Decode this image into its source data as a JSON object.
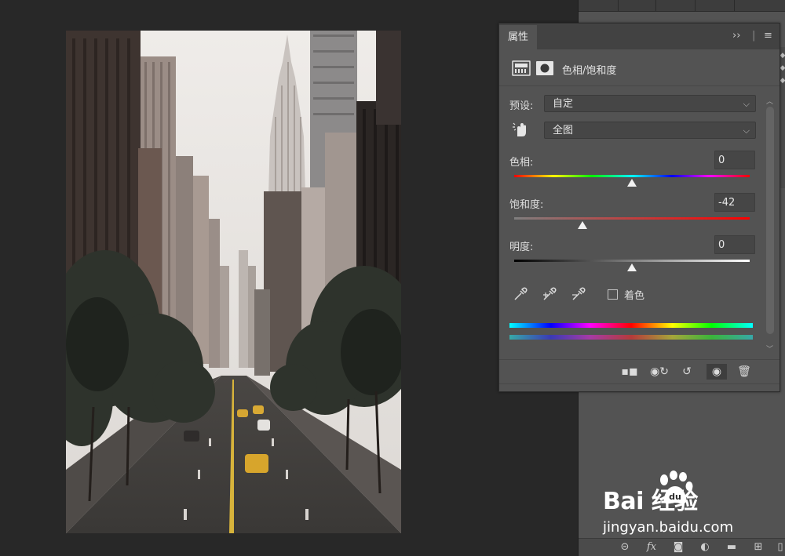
{
  "panel": {
    "tab_label": "属性",
    "expand_label": "››",
    "menu_label": "≡",
    "adjustment_title": "色相/饱和度",
    "preset_label": "预设:",
    "preset_value": "自定",
    "channel_value": "全图",
    "hue": {
      "label": "色相:",
      "value": "0",
      "level": 0.5
    },
    "saturation": {
      "label": "饱和度:",
      "value": "-42",
      "level": 0.29
    },
    "lightness": {
      "label": "明度:",
      "value": "0",
      "level": 0.5
    },
    "colorize_label": "着色"
  },
  "watermark": {
    "brand": "Bai   经验",
    "site": "jingyan.baidu.com"
  },
  "colors": {
    "panel_bg": "#535353",
    "canvas_bg": "#282828",
    "thumb": "#f2f2f2"
  }
}
